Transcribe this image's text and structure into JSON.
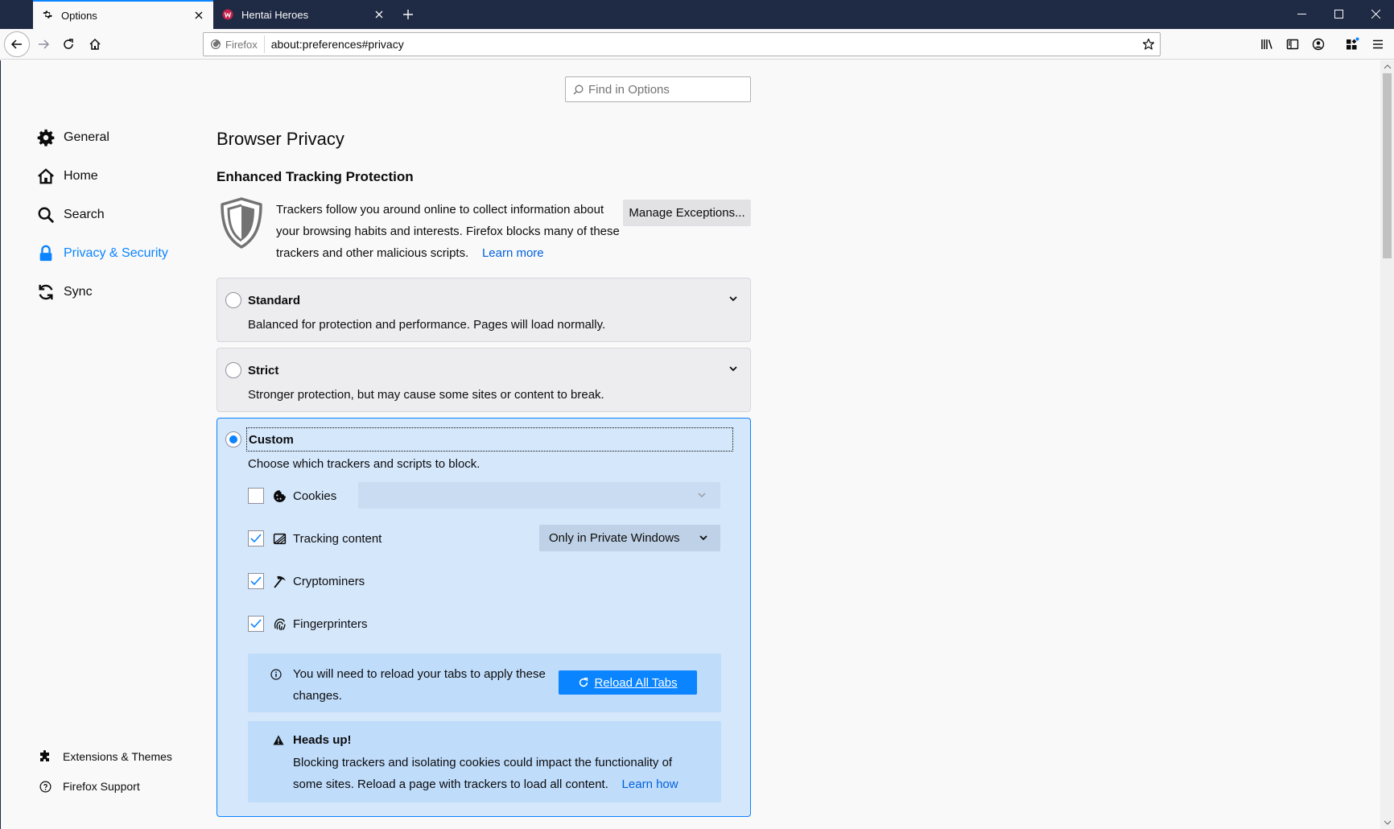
{
  "tabs": [
    {
      "title": "Options",
      "icon": "gear-icon",
      "active": true
    },
    {
      "title": "Hentai Heroes",
      "icon": "site-favicon",
      "active": false
    }
  ],
  "navbar": {
    "identity_label": "Firefox",
    "url": "about:preferences#privacy"
  },
  "search": {
    "placeholder": "Find in Options"
  },
  "sidebar": {
    "items": [
      {
        "label": "General",
        "icon": "gear-icon"
      },
      {
        "label": "Home",
        "icon": "home-icon"
      },
      {
        "label": "Search",
        "icon": "search-icon"
      },
      {
        "label": "Privacy & Security",
        "icon": "lock-icon",
        "selected": true
      },
      {
        "label": "Sync",
        "icon": "sync-icon"
      }
    ],
    "footer": [
      {
        "label": "Extensions & Themes",
        "icon": "puzzle-icon"
      },
      {
        "label": "Firefox Support",
        "icon": "help-icon"
      }
    ]
  },
  "main": {
    "title": "Browser Privacy",
    "etp": {
      "heading": "Enhanced Tracking Protection",
      "description": "Trackers follow you around online to collect information about your browsing habits and interests. Firefox blocks many of these trackers and other malicious scripts.",
      "learn_more": "Learn more",
      "manage_exceptions": "Manage Exceptions..."
    },
    "standard": {
      "label": "Standard",
      "description": "Balanced for protection and performance. Pages will load normally."
    },
    "strict": {
      "label": "Strict",
      "description": "Stronger protection, but may cause some sites or content to break."
    },
    "custom": {
      "label": "Custom",
      "description": "Choose which trackers and scripts to block.",
      "options": [
        {
          "label": "Cookies",
          "checked": false
        },
        {
          "label": "Tracking content",
          "checked": true,
          "select_value": "Only in Private Windows"
        },
        {
          "label": "Cryptominers",
          "checked": true
        },
        {
          "label": "Fingerprinters",
          "checked": true
        }
      ],
      "reload_notice": "You will need to reload your tabs to apply these changes.",
      "reload_button": "Reload All Tabs",
      "warning_title": "Heads up!",
      "warning_text": "Blocking trackers and isolating cookies could impact the functionality of some sites. Reload a page with trackers to load all content.",
      "warning_link": "Learn how"
    }
  },
  "colors": {
    "accent": "#0a84ff",
    "titlebar": "#1f2a44",
    "custom_bg": "#d5e7fb"
  }
}
